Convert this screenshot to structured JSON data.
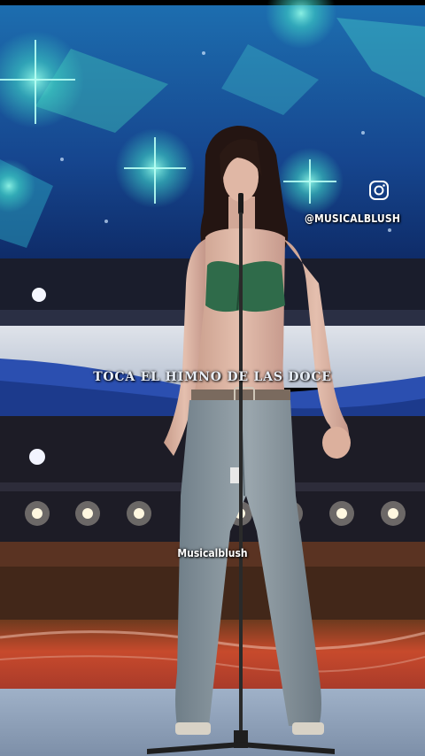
{
  "overlay": {
    "social_handle": "@MUSICALBLUSH",
    "subtitle": "TOCA EL HIMNO DE LAS DOCE",
    "watermark": "Musicalblush"
  },
  "icons": {
    "social": "instagram-icon"
  },
  "colors": {
    "stage_blue": "#1f3f8a",
    "spark_teal": "#38c8c0",
    "floor_red": "#b8402e",
    "top_green": "#2f6b4a",
    "jeans": "#7f8c94",
    "text_white": "#ffffff"
  }
}
